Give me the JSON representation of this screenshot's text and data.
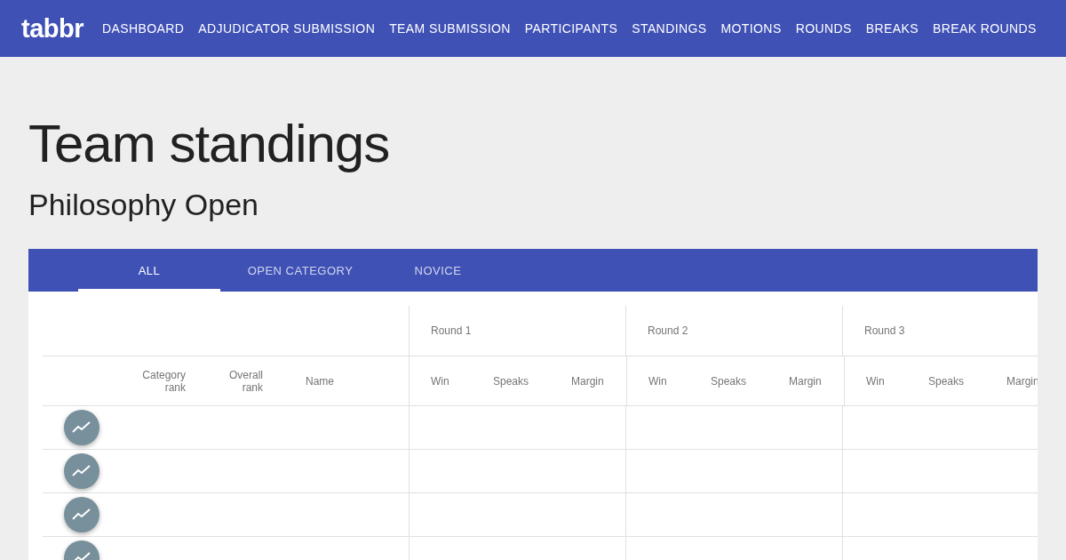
{
  "navbar": {
    "logo": "tabbr",
    "links": [
      "DASHBOARD",
      "ADJUDICATOR SUBMISSION",
      "TEAM SUBMISSION",
      "PARTICIPANTS",
      "STANDINGS",
      "MOTIONS",
      "ROUNDS",
      "BREAKS",
      "BREAK ROUNDS"
    ]
  },
  "title": "Team standings",
  "subtitle": "Philosophy Open",
  "tabs": [
    {
      "label": "ALL",
      "selected": true
    },
    {
      "label": "OPEN CATEGORY",
      "selected": false
    },
    {
      "label": "NOVICE",
      "selected": false
    }
  ],
  "table": {
    "columns": [
      "Category rank",
      "Overall rank",
      "Name"
    ],
    "rounds": [
      {
        "name": "Round 1",
        "columns": [
          "Win",
          "Speaks",
          "Margin"
        ]
      },
      {
        "name": "Round 2",
        "columns": [
          "Win",
          "Speaks",
          "Margin"
        ]
      },
      {
        "name": "Round 3",
        "columns": [
          "Win",
          "Speaks",
          "Margin"
        ]
      }
    ],
    "rows": [
      {
        "kind": "chart-button"
      },
      {
        "kind": "chart-button"
      },
      {
        "kind": "chart-button"
      },
      {
        "kind": "chart-button"
      }
    ]
  }
}
